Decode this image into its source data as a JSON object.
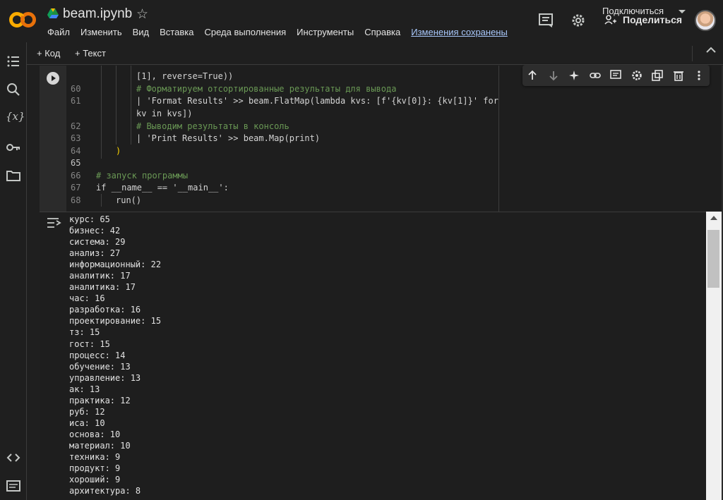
{
  "header": {
    "title": "beam.ipynb",
    "menu": [
      "Файл",
      "Изменить",
      "Вид",
      "Вставка",
      "Среда выполнения",
      "Инструменты",
      "Справка"
    ],
    "saved_status": "Изменения сохранены",
    "share_label": "Поделиться"
  },
  "toolbar": {
    "add_code": "+ Код",
    "add_text": "+ Текст",
    "connect": "Подключиться"
  },
  "cell": {
    "lines": [
      {
        "n": "",
        "text": "[1], reverse=True))"
      },
      {
        "n": "60",
        "text": "# Форматируем отсортированные результаты для вывода"
      },
      {
        "n": "61",
        "text": "| 'Format Results' >> beam.FlatMap(lambda kvs: [f'{kv[0]}: {kv[1]}' for"
      },
      {
        "n": "",
        "text": "kv in kvs])"
      },
      {
        "n": "62",
        "text": "# Выводим результаты в консоль"
      },
      {
        "n": "63",
        "text": "| 'Print Results' >> beam.Map(print)"
      },
      {
        "n": "64",
        "text": ")"
      },
      {
        "n": "65",
        "text": ""
      },
      {
        "n": "66",
        "text": "# запуск программы"
      },
      {
        "n": "67",
        "text": "if __name__ == '__main__':"
      },
      {
        "n": "68",
        "text": "run()"
      }
    ]
  },
  "output": {
    "lines": [
      "курс: 65",
      "бизнес: 42",
      "система: 29",
      "анализ: 27",
      "информационный: 22",
      "аналитик: 17",
      "аналитика: 17",
      "час: 16",
      "разработка: 16",
      "проектирование: 15",
      "тз: 15",
      "гост: 15",
      "процесс: 14",
      "обучение: 13",
      "управление: 13",
      "ак: 13",
      "практика: 12",
      "руб: 12",
      "иса: 10",
      "основа: 10",
      "материал: 10",
      "техника: 9",
      "продукт: 9",
      "хороший: 9",
      "архитектура: 8"
    ]
  }
}
